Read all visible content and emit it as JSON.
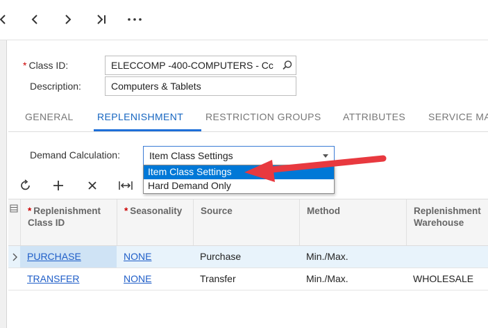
{
  "nav": {
    "icons": [
      "chevron-left-icon",
      "chevron-left-icon",
      "chevron-right-icon",
      "last-page-icon",
      "more-icon"
    ]
  },
  "form": {
    "class_id_label": "Class ID:",
    "class_id_value": "ELECCOMP  -400-COMPUTERS - Cc",
    "description_label": "Description:",
    "description_value": "Computers & Tablets"
  },
  "tabs": [
    {
      "label": "GENERAL",
      "active": false
    },
    {
      "label": "REPLENISHMENT",
      "active": true
    },
    {
      "label": "RESTRICTION GROUPS",
      "active": false
    },
    {
      "label": "ATTRIBUTES",
      "active": false
    },
    {
      "label": "SERVICE MA",
      "active": false
    }
  ],
  "demand": {
    "label": "Demand Calculation:",
    "value": "Item Class Settings",
    "options": [
      "Item Class Settings",
      "Hard Demand Only"
    ],
    "selected_index": 0
  },
  "toolbar": {
    "icons": [
      "refresh-icon",
      "add-icon",
      "delete-icon",
      "fit-columns-icon"
    ]
  },
  "grid": {
    "headers": {
      "replenishment_class_line1": "Replenishment",
      "replenishment_class_line2": "Class ID",
      "seasonality": "Seasonality",
      "source": "Source",
      "method": "Method",
      "warehouse_line1": "Replenishment",
      "warehouse_line2": "Warehouse"
    },
    "rows": [
      {
        "class_id": "PURCHASE",
        "seasonality": "NONE",
        "source": "Purchase",
        "method": "Min./Max.",
        "warehouse": ""
      },
      {
        "class_id": "TRANSFER",
        "seasonality": "NONE",
        "source": "Transfer",
        "method": "Min./Max.",
        "warehouse": "WHOLESALE"
      }
    ]
  },
  "colors": {
    "accent": "#1e6fd9",
    "selected_option": "#0078d7",
    "annotation_arrow": "#e8393f",
    "link": "#1f5ec8"
  }
}
